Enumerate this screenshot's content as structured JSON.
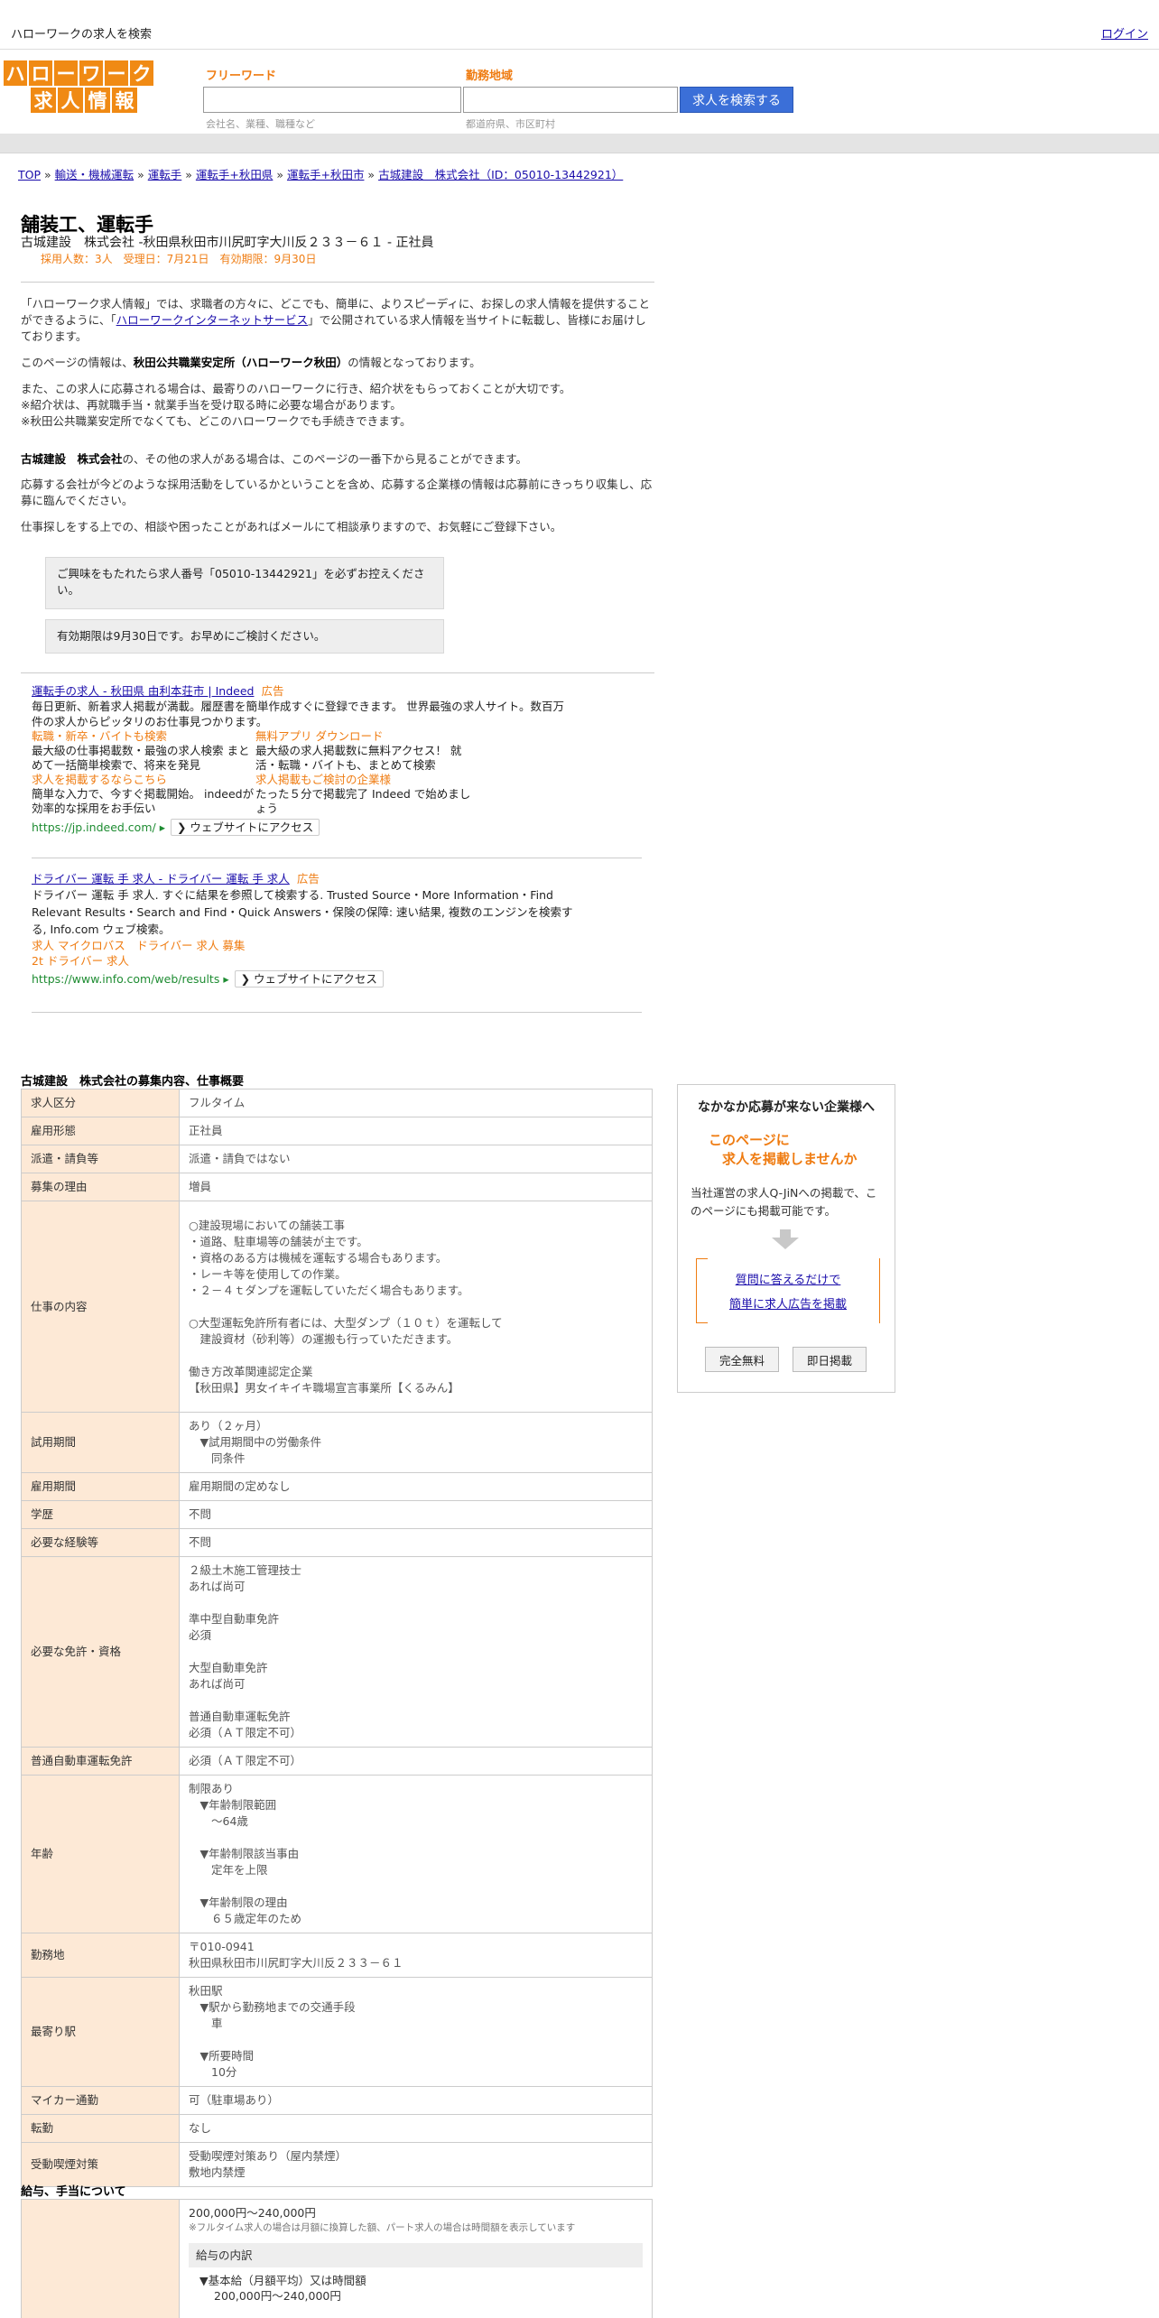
{
  "topbar": {
    "title": "ハローワークの求人を検索",
    "login": "ログイン"
  },
  "logo": {
    "row1": [
      "ハ",
      "ロ",
      "ー",
      "ワ",
      "ー",
      "ク"
    ],
    "row2": [
      "求",
      "人",
      "情",
      "報"
    ]
  },
  "search": {
    "freeword_label": "フリーワード",
    "freeword_placeholder": "会社名、業種、職種など",
    "area_label": "勤務地域",
    "area_placeholder": "都道府県、市区町村",
    "button": "求人を検索する"
  },
  "breadcrumb": [
    "TOP",
    "輸送・機械運転",
    "運転手",
    "運転手+秋田県",
    "運転手+秋田市",
    "古城建設　株式会社（ID：05010-13442921）"
  ],
  "job": {
    "title": "舗装工、運転手",
    "subtitle": "古城建設　株式会社 -秋田県秋田市川尻町字大川反２３３－６１ - 正社員",
    "meta": "採用人数：3人　受理日：7月21日　有効期限：9月30日"
  },
  "intro": {
    "p1a": "「ハローワーク求人情報」では、求職者の方々に、どこでも、簡単に、よりスピーディに、お探しの求人情報を提供することができるように、「",
    "p1link": "ハローワークインターネットサービス",
    "p1b": "」で公開されている求人情報を当サイトに転載し、皆様にお届けしております。",
    "p2a": "このページの情報は、",
    "p2b": "秋田公共職業安定所（ハローワーク秋田）",
    "p2c": "の情報となっております。",
    "p3": "また、この求人に応募される場合は、最寄りのハローワークに行き、紹介状をもらっておくことが大切です。",
    "p4": "※紹介状は、再就職手当・就業手当を受け取る時に必要な場合があります。",
    "p5": "※秋田公共職業安定所でなくても、どこのハローワークでも手続きできます。",
    "p6a": "古城建設　株式会社",
    "p6b": "の、その他の求人がある場合は、このページの一番下から見ることができます。",
    "p7": "応募する会社が今どのような採用活動をしているかということを含め、応募する企業様の情報は応募前にきっちり収集し、応募に臨んでください。",
    "p8": "仕事探しをする上での、相談や困ったことがあればメールにて相談承りますので、お気軽にご登録下さい。"
  },
  "notes": {
    "n1": "ご興味をもたれたら求人番号「05010-13442921」を必ずお控えください。",
    "n2": "有効期限は9月30日です。お早めにご検討ください。"
  },
  "ads": [
    {
      "title": "運転手の求人 - 秋田県 由利本荘市 | Indeed",
      "tag": "広告",
      "desc": "毎日更新、新着求人掲載が満載。履歴書を簡単作成すぐに登録できます。 世界最強の求人サイト。数百万件の求人からピッタリのお仕事見つかります。",
      "subs": [
        {
          "h": "転職・新卒・バイトも検索",
          "d": "最大級の仕事掲載数・最強の求人検索 まとめて一括簡単検索で、将来を発見"
        },
        {
          "h": "無料アプリ ダウンロード",
          "d": "最大級の求人掲載数に無料アクセス！ 就活・転職・バイトも、まとめて検索"
        },
        {
          "h": "求人を掲載するならこちら",
          "d": "簡単な入力で、今すぐ掲載開始。 indeedが効率的な採用をお手伝い"
        },
        {
          "h": "求人掲載もご検討の企業様",
          "d": "たった５分で掲載完了 Indeed で始めましょう"
        }
      ],
      "url": "https://jp.indeed.com/",
      "visit": "ウェブサイトにアクセス"
    },
    {
      "title": "ドライバー 運転 手 求人 - ドライバー 運転 手 求人",
      "tag": "広告",
      "desc": "ドライバー 運転 手 求人. すぐに結果を参照して検索する. Trusted Source・More Information・Find Relevant Results・Search and Find・Quick Answers・保険の保障: 速い結果, 複数のエンジンを検索する, Info.com ウェブ検索。",
      "links1": "求人 マイクロバス　ドライバー 求人 募集",
      "links2": "2t ドライバー 求人",
      "url": "https://www.info.com/web/results",
      "visit": "ウェブサイトにアクセス"
    }
  ],
  "detail_title": "古城建設　株式会社の募集内容、仕事概要",
  "detail_rows": [
    {
      "k": "求人区分",
      "v": "フルタイム"
    },
    {
      "k": "雇用形態",
      "v": "正社員"
    },
    {
      "k": "派遣・請負等",
      "v": "派遣・請負ではない"
    },
    {
      "k": "募集の理由",
      "v": "増員"
    },
    {
      "k": "仕事の内容",
      "v": "○建設現場においての舗装工事\n・道路、駐車場等の舗装が主です。\n・資格のある方は機械を運転する場合もあります。\n・レーキ等を使用しての作業。\n・２－４ｔダンプを運転していただく場合もあります。\n\n○大型運転免許所有者には、大型ダンプ（１０ｔ）を運転して\n　建設資材（砂利等）の運搬も行っていただきます。\n\n働き方改革関連認定企業\n【秋田県】男女イキイキ職場宣言事業所【くるみん】"
    },
    {
      "k": "試用期間",
      "v": "あり（２ヶ月）\n　▼試用期間中の労働条件\n　　同条件"
    },
    {
      "k": "雇用期間",
      "v": "雇用期間の定めなし"
    },
    {
      "k": "学歴",
      "v": "不問"
    },
    {
      "k": "必要な経験等",
      "v": "不問"
    },
    {
      "k": "必要な免許・資格",
      "v": "２級土木施工管理技士\nあれば尚可\n\n準中型自動車免許\n必須\n\n大型自動車免許\nあれば尚可\n\n普通自動車運転免許\n必須（ＡＴ限定不可）"
    },
    {
      "k": "普通自動車運転免許",
      "v": "必須（ＡＴ限定不可）"
    },
    {
      "k": "年齢",
      "v": "制限あり\n　▼年齢制限範囲\n　　〜64歳\n\n　▼年齢制限該当事由\n　　定年を上限\n\n　▼年齢制限の理由\n　　６５歳定年のため"
    },
    {
      "k": "勤務地",
      "v": "〒010-0941\n秋田県秋田市川尻町字大川反２３３－６１"
    },
    {
      "k": "最寄り駅",
      "v": "秋田駅\n　▼駅から勤務地までの交通手段\n　　車\n\n　▼所要時間\n　　10分"
    },
    {
      "k": "マイカー通勤",
      "v": "可（駐車場あり）"
    },
    {
      "k": "転勤",
      "v": "なし"
    },
    {
      "k": "受動喫煙対策",
      "v": "受動喫煙対策あり（屋内禁煙）\n敷地内禁煙"
    }
  ],
  "pay_title": "給与、手当について",
  "pay": {
    "range": "200,000円〜240,000円",
    "note": "※フルタイム求人の場合は月額に換算した額、パート求人の場合は時間額を表示しています",
    "box": "給与の内訳",
    "base_label": "▼基本給（月額平均）又は時間額",
    "base_value": "200,000円〜240,000円"
  },
  "side": {
    "heading": "なかなか応募が来ない企業様へ",
    "offer1": "このページに",
    "offer2": "求人を掲載しませんか",
    "body": "当社運営の求人Q-JiNへの掲載で、このページにも掲載可能です。",
    "link1": "質問に答えるだけで",
    "link2": "簡単に求人広告を掲載",
    "btn1": "完全無料",
    "btn2": "即日掲載"
  }
}
